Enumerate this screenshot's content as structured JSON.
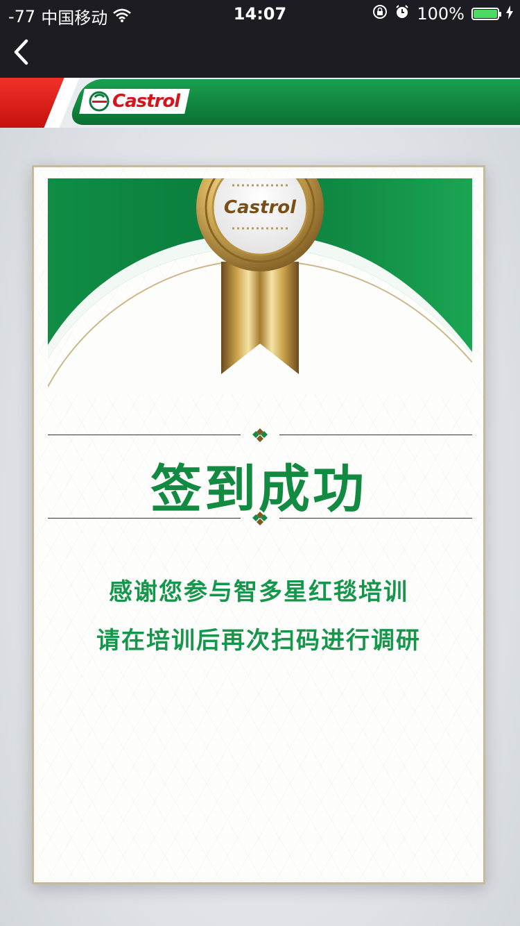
{
  "status_bar": {
    "signal": "-77",
    "carrier": "中国移动",
    "time": "14:07",
    "battery": "100%",
    "battery_level": 1.0
  },
  "nav": {
    "back_icon": "chevron-left-icon"
  },
  "brand": {
    "logo_text": "Castrol"
  },
  "medal": {
    "logo_text": "Castrol"
  },
  "card": {
    "title": "签到成功",
    "line1": "感谢您参与智多星红毯培训",
    "line2": "请在培训后再次扫码进行调研"
  },
  "colors": {
    "brand_green": "#138a42",
    "brand_red": "#d6141b",
    "gold": "#c9a24a"
  }
}
